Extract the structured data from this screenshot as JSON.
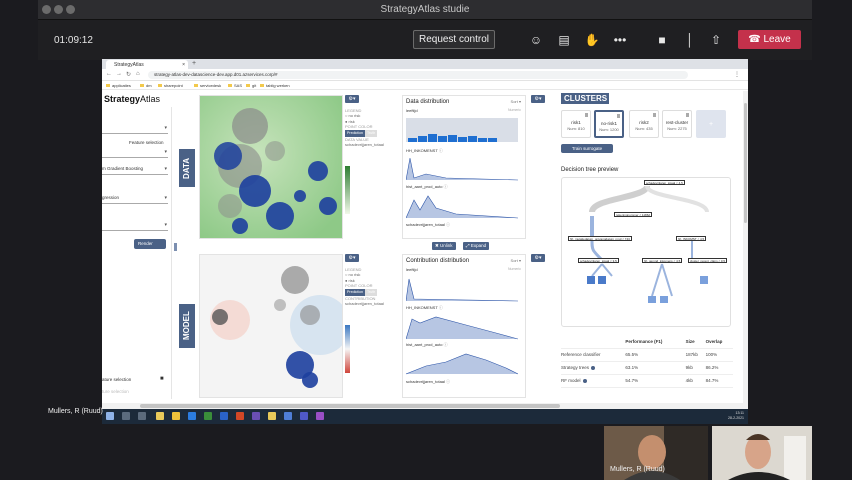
{
  "window": {
    "title": "StrategyAtlas studie"
  },
  "meeting": {
    "timer": "01:09:12",
    "request_control": "Request control",
    "leave": "Leave",
    "presenter_name": "Mullers, R (Ruud)",
    "participant_name": "Mullers, R (Ruud)"
  },
  "browser": {
    "tab_title": "StrategyAtlas",
    "url": "strategy-atlas-dev-datascience-dev.app.d01.azservices.corp/#",
    "bookmarks": [
      "applicaties",
      "dm",
      "sharepoint",
      "servicedesk",
      "SAS",
      "git",
      "tablig werken"
    ]
  },
  "app": {
    "brand_bold": "Strategy",
    "brand_rest": "Atlas",
    "left": {
      "feature_selection": "Feature selection",
      "model_select": "m Gradient Boosting",
      "task_select": "gression",
      "render": "Render",
      "feature_selection_bottom": "ature selection",
      "feature_selection_faded": "ture selection"
    },
    "data_label": "DATA",
    "model_label": "MODEL",
    "legend": {
      "title": "LEGEND",
      "item1": "no risk",
      "item2": "risk",
      "point_color": "POINT COLOR",
      "prediction": "Prediction",
      "truth": "Truth",
      "data_value": "DATA VALUE",
      "data_value_feature": "schadevrijjaren_totaal",
      "contribution": "CONTRIBUTION",
      "contribution_feature": "schadevrijjaren_totaal"
    },
    "data_dist": {
      "title": "Data distribution",
      "sort": "Sort",
      "features": [
        "leeftijd",
        "HH_INKOMENST",
        "hist_aant_prod_auto",
        "schadevrijjaren_totaal"
      ],
      "axis_label": "Numeric"
    },
    "contrib_dist": {
      "title": "Contribution distribution",
      "sort": "Sort",
      "features": [
        "leeftijd",
        "HH_INKOMENST",
        "hist_aant_prod_auto",
        "schadevrijjaren_totaal"
      ],
      "axis_label": "Numeric"
    },
    "unlink": "Unlink",
    "expand": "Expand",
    "clusters": {
      "title": "CLUSTERS",
      "cards": [
        {
          "name": "risk1",
          "count": "Num: 810"
        },
        {
          "name": "no-risk1",
          "count": "Num: 1200"
        },
        {
          "name": "risk2",
          "count": "Num: 435"
        },
        {
          "name": "rest-cluster",
          "count": "Num: 2275"
        }
      ],
      "add": "+",
      "train_surrogate": "Train surrogate"
    },
    "tree": {
      "title": "Decision tree preview",
      "nodes": [
        "schadevrijjaren_totaal < 4.5",
        "rekeningnummer < 11862",
        "hh_mutatiedatum_ontvangdatum_mnd < 743",
        "hh_INKOMST < 4.5",
        "schadevrijjaren_totaal < 3.5",
        "hh_gemnd_inkomens < 4.5",
        "cluster_recent_claim < 0.5"
      ]
    },
    "performance": {
      "headers": [
        "",
        "Performance (F1)",
        "Size",
        "Overlap"
      ],
      "rows": [
        {
          "name": "Reference classifier",
          "perf": "65.5%",
          "size": "187kb",
          "overlap": "100%"
        },
        {
          "name": "Strategy trees",
          "perf": "63.1%",
          "size": "9kb",
          "overlap": "86.2%"
        },
        {
          "name": "RF model",
          "perf": "54.7%",
          "size": "4kb",
          "overlap": "84.7%"
        }
      ]
    }
  },
  "taskbar": {
    "time": "13:11",
    "date": "28-2-2021"
  },
  "colors": {
    "accent": "#4a6186",
    "leave": "#c4314b",
    "bar_blue": "#1f6fd1"
  }
}
